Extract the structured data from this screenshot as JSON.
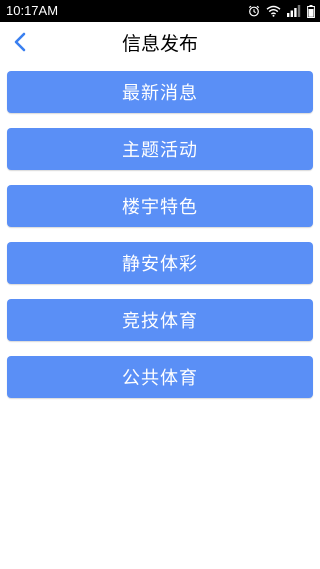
{
  "status_bar": {
    "time": "10:17AM",
    "icons": [
      "alarm-icon",
      "wifi-icon",
      "signal-icon",
      "battery-icon"
    ]
  },
  "header": {
    "title": "信息发布",
    "back_icon": "chevron-left-icon"
  },
  "colors": {
    "accent": "#5a8ff6",
    "back_arrow": "#3a7ff0",
    "status_bar_bg": "#000000"
  },
  "menu": {
    "items": [
      {
        "label": "最新消息"
      },
      {
        "label": "主题活动"
      },
      {
        "label": "楼宇特色"
      },
      {
        "label": "静安体彩"
      },
      {
        "label": "竞技体育"
      },
      {
        "label": "公共体育"
      }
    ]
  }
}
